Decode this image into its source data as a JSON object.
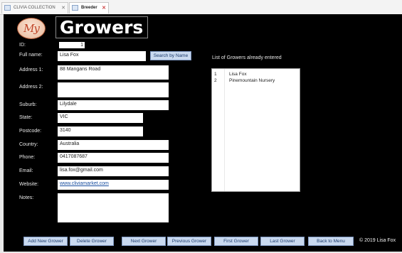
{
  "tabs": [
    {
      "label": "CLIVIA COLLECTION",
      "active": false
    },
    {
      "label": "Breeder",
      "active": true
    }
  ],
  "header": {
    "logo_text": "My",
    "title": "Growers"
  },
  "fields": {
    "id": {
      "label": "ID:",
      "value": "1"
    },
    "full_name": {
      "label": "Full name:",
      "value": "Lisa Fox"
    },
    "address1": {
      "label": "Address 1:",
      "value": "88 Mangans Road"
    },
    "address2": {
      "label": "Address 2:",
      "value": ""
    },
    "suburb": {
      "label": "Suburb:",
      "value": "Lilydale"
    },
    "state": {
      "label": "State:",
      "value": "VIC"
    },
    "postcode": {
      "label": "Postcode:",
      "value": "3140"
    },
    "country": {
      "label": "Country:",
      "value": "Australia"
    },
    "phone": {
      "label": "Phone:",
      "value": "0417087687"
    },
    "email": {
      "label": "Email:",
      "value": "lisa.fox@gmail.com"
    },
    "website": {
      "label": "Website:",
      "value": "www.cliviamarket.com"
    },
    "notes": {
      "label": "Notes:",
      "value": ""
    }
  },
  "search_button": "Search by Name",
  "growers_list": {
    "caption": "List of Growers already entered",
    "rows": [
      {
        "id": "1",
        "name": "Lisa Fox"
      },
      {
        "id": "2",
        "name": "Pinemountain Nursery"
      }
    ]
  },
  "buttons": {
    "add_new": "Add New Grower",
    "delete": "Delete Grower",
    "next": "Next Grower",
    "previous": "Previous Grower",
    "first": "First Grower",
    "last": "Last Grower",
    "back": "Back to Menu"
  },
  "copyright": "© 2019 Lisa Fox",
  "colors": {
    "form_bg": "#000000",
    "button_bg": "#c9d9ef",
    "button_border": "#7f98c2",
    "link": "#1a4fa0"
  }
}
